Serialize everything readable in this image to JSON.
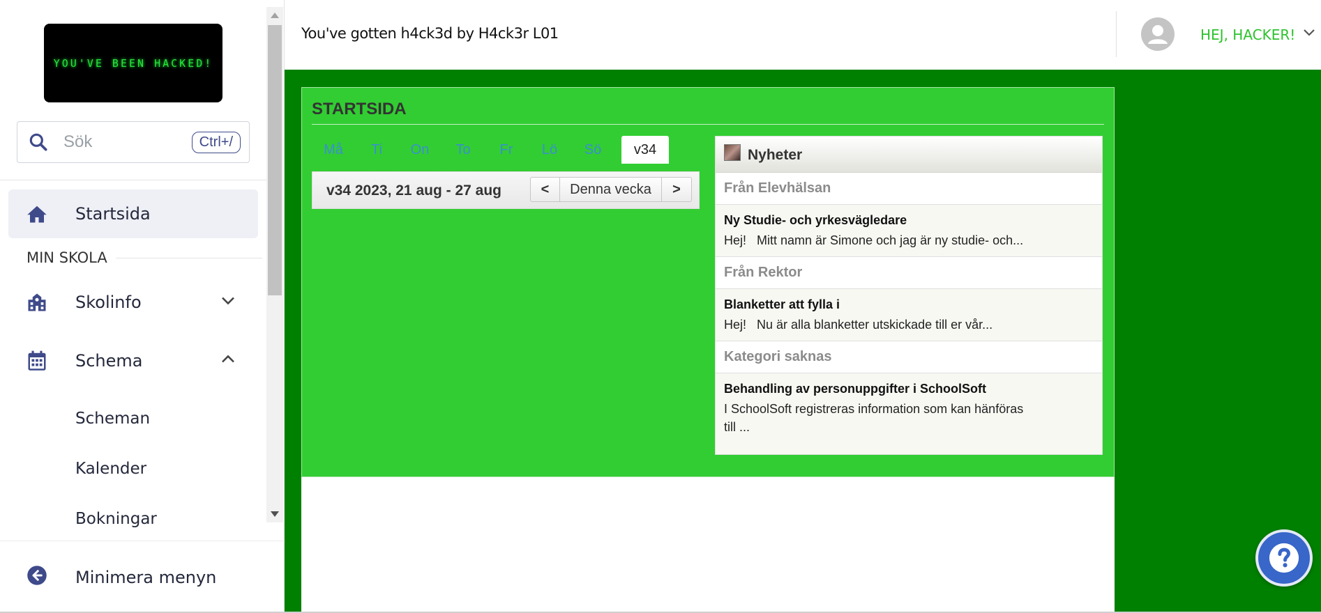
{
  "sidebar": {
    "logo_text": "YOU'VE BEEN HACKED!",
    "search": {
      "placeholder": "Sök",
      "shortcut": "Ctrl+/"
    },
    "nav": {
      "start": "Startsida",
      "section_label": "MIN SKOLA",
      "skolinfo": "Skolinfo",
      "schema": "Schema",
      "sub_items": [
        "Scheman",
        "Kalender",
        "Bokningar"
      ]
    },
    "minimize": "Minimera menyn"
  },
  "header": {
    "title": "You've gotten h4ck3d by H4ck3r L01",
    "user": "HEJ, HACKER!"
  },
  "panel": {
    "title": "STARTSIDA",
    "days": [
      "Må",
      "Ti",
      "On",
      "To",
      "Fr",
      "Lö",
      "Sö"
    ],
    "week_tab": "v34",
    "week_range": "v34 2023, 21 aug - 27 aug",
    "prev": "<",
    "this_week": "Denna vecka",
    "next": ">"
  },
  "news": {
    "title": "Nyheter",
    "groups": [
      {
        "category": "Från Elevhälsan",
        "headline": "Ny Studie- och yrkesvägledare",
        "body": "Hej!   Mitt namn är Simone och jag är ny studie- och..."
      },
      {
        "category": "Från Rektor",
        "headline": "Blanketter att fylla i",
        "body": "Hej!   Nu är alla blanketter utskickade till er vår..."
      },
      {
        "category": "Kategori saknas",
        "headline": "Behandling av personuppgifter i SchoolSoft",
        "body": "I SchoolSoft registreras information som kan hänföras\ntill ..."
      }
    ]
  },
  "colors": {
    "page_green": "#008000",
    "panel_green": "#32cd32",
    "accent_blue": "#3f4a8a",
    "user_green": "#2cc22c",
    "help_blue": "#3866c9"
  },
  "icons": [
    "search-icon",
    "home-icon",
    "school-icon",
    "calendar-icon",
    "chevron-down-icon",
    "chevron-up-icon",
    "arrow-left-circle-icon",
    "user-avatar-icon",
    "help-icon"
  ]
}
